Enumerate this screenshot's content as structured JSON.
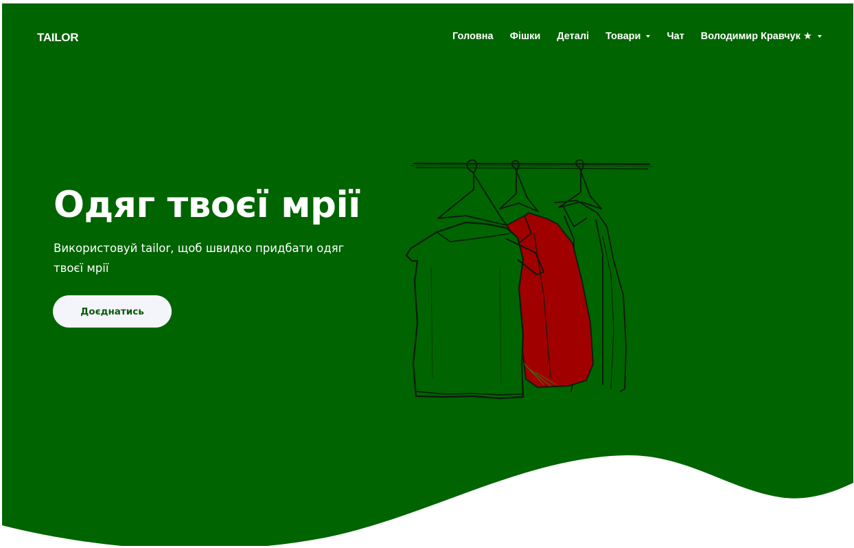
{
  "brand": {
    "name": "TAILOR"
  },
  "nav": {
    "items": [
      {
        "label": "Головна"
      },
      {
        "label": "Фішки"
      },
      {
        "label": "Деталі"
      },
      {
        "label": "Товари"
      },
      {
        "label": "Чат"
      }
    ],
    "user": {
      "label": "Володимир Кравчук ★"
    }
  },
  "hero": {
    "title": "Одяг твоєї мрії",
    "subtitle": "Використовуй tailor, щоб швидко придбати одяг твоєї мрії",
    "cta_label": "Доєднатись"
  },
  "colors": {
    "hero_bg": "#006400",
    "accent_red": "#a00000",
    "button_bg": "#f4f5fb",
    "text": "#ffffff"
  },
  "icons": {
    "dropdown": "caret-down-icon",
    "illustration": "clothes-rack-illustration"
  }
}
